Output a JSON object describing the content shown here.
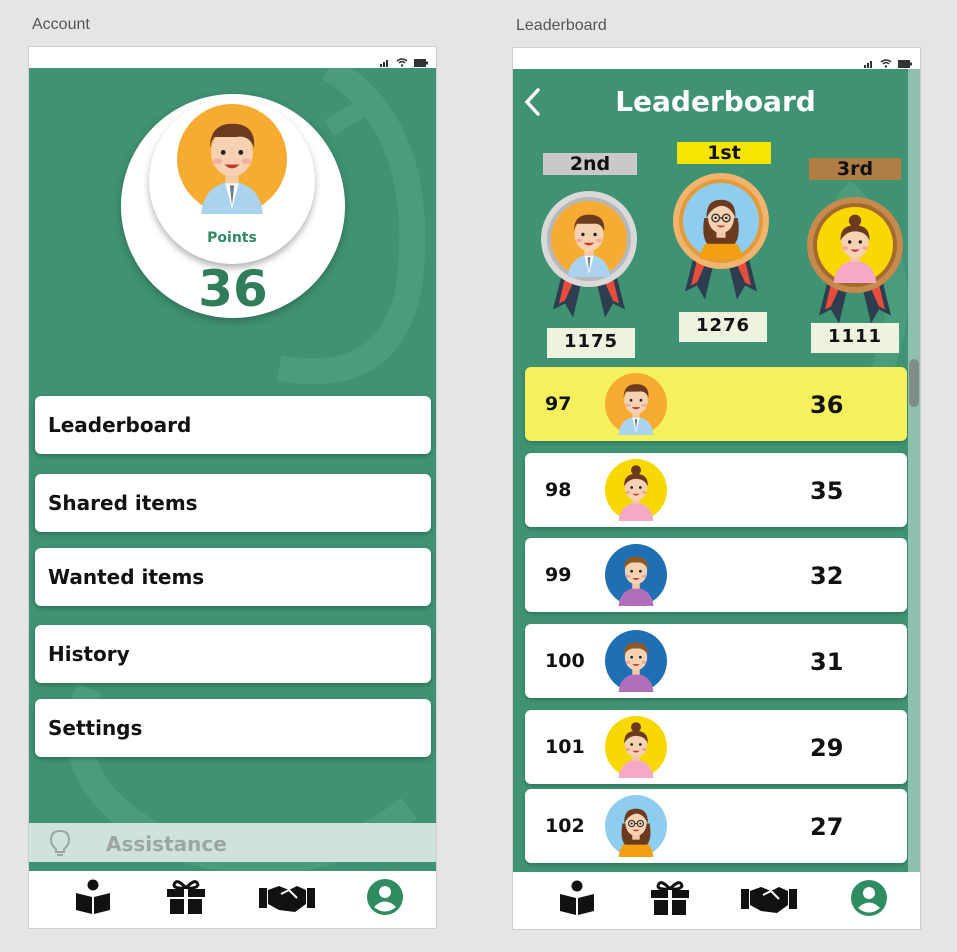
{
  "account": {
    "frame_label": "Account",
    "points_label": "Points",
    "points_value": "36",
    "menu": [
      {
        "label": "Leaderboard"
      },
      {
        "label": "Shared items"
      },
      {
        "label": "Wanted items"
      },
      {
        "label": "History"
      },
      {
        "label": "Settings"
      }
    ],
    "assistance_label": "Assistance",
    "tabs": [
      "book-icon",
      "gift-icon",
      "handshake-icon",
      "user-icon"
    ]
  },
  "leaderboard": {
    "frame_label": "Leaderboard",
    "title": "Leaderboard",
    "podium": {
      "first": {
        "label": "1st",
        "score": "1276",
        "color": "#f7e400"
      },
      "second": {
        "label": "2nd",
        "score": "1175",
        "color": "#c9c9c9"
      },
      "third": {
        "label": "3rd",
        "score": "1111",
        "color": "#b07d45"
      }
    },
    "rows": [
      {
        "rank": "97",
        "score": "36",
        "highlight": true,
        "avatar": "boy-orange"
      },
      {
        "rank": "98",
        "score": "35",
        "highlight": false,
        "avatar": "girl-yellow"
      },
      {
        "rank": "99",
        "score": "32",
        "highlight": false,
        "avatar": "boy-blue"
      },
      {
        "rank": "100",
        "score": "31",
        "highlight": false,
        "avatar": "boy-blue"
      },
      {
        "rank": "101",
        "score": "29",
        "highlight": false,
        "avatar": "girl-yellow"
      },
      {
        "rank": "102",
        "score": "27",
        "highlight": false,
        "avatar": "girl-glasses"
      }
    ]
  },
  "colors": {
    "primary_green": "#3f9272",
    "highlight_yellow": "#f5f15d",
    "icon_green": "#2f8b60"
  }
}
